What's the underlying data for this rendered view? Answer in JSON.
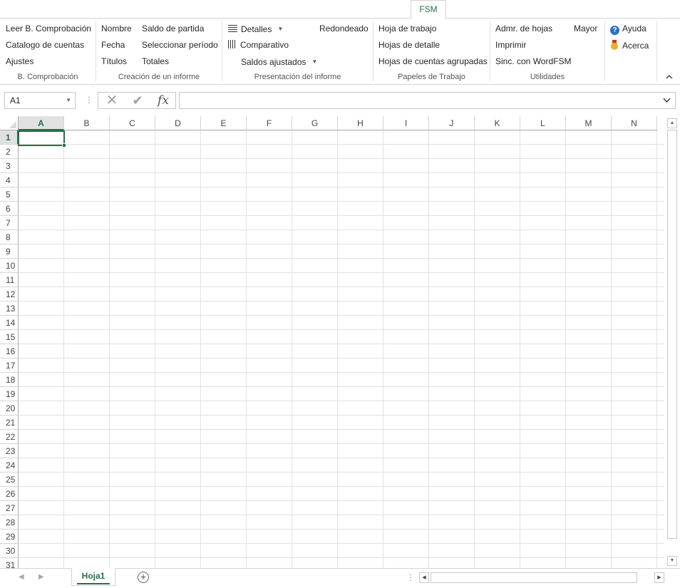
{
  "ribbon": {
    "active_tab": "FSM",
    "groups": {
      "bcomp": {
        "label": "B. Comprobación",
        "items": [
          "Leer B. Comprobación",
          "Catalogo de cuentas",
          "Ajustes"
        ]
      },
      "creacion": {
        "label": "Creación de un informe",
        "items": [
          "Nombre",
          "Fecha",
          "Títulos",
          "Saldo de partida",
          "Seleccionar período",
          "Totales"
        ]
      },
      "presentacion": {
        "label": "Presentación del informe",
        "items": [
          "Detalles",
          "Comparativo",
          "Saldos ajustados",
          "Redondeado"
        ]
      },
      "papeles": {
        "label": "Papeles de Trabajo",
        "items": [
          "Hoja de trabajo",
          "Hojas de detalle",
          "Hojas de cuentas agrupadas"
        ]
      },
      "utilidades": {
        "label": "Utilidades",
        "items": [
          "Admr. de hojas",
          "Imprimir",
          "Sinc. con WordFSM",
          "Mayor"
        ]
      },
      "ayuda": {
        "items": [
          "Ayuda",
          "Acerca"
        ]
      }
    }
  },
  "formula_bar": {
    "name_box": "A1",
    "cancel_icon": "close-icon",
    "enter_icon": "check-icon",
    "function_label": "fx",
    "formula": ""
  },
  "grid": {
    "columns": [
      "A",
      "B",
      "C",
      "D",
      "E",
      "F",
      "G",
      "H",
      "I",
      "J",
      "K",
      "L",
      "M",
      "N"
    ],
    "rows": [
      "1",
      "2",
      "3",
      "4",
      "5",
      "6",
      "7",
      "8",
      "9",
      "10",
      "11",
      "12",
      "13",
      "14",
      "15",
      "16",
      "17",
      "18",
      "19",
      "20",
      "21",
      "22",
      "23",
      "24",
      "25",
      "26",
      "27",
      "28",
      "29",
      "30",
      "31"
    ],
    "selected_cell": "A1"
  },
  "sheets": {
    "tabs": [
      "Hoja1"
    ],
    "active": "Hoja1"
  },
  "colors": {
    "accent": "#217346",
    "gridline": "#e1e1e1"
  }
}
